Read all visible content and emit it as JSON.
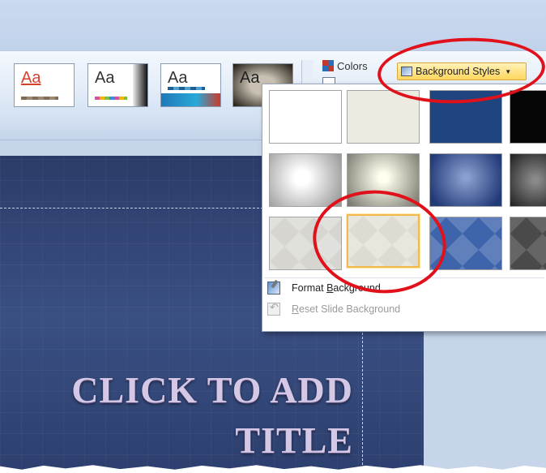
{
  "ribbon": {
    "themes": [
      {
        "label": "Aa"
      },
      {
        "label": "Aa"
      },
      {
        "label": "Aa"
      },
      {
        "label": "Aa"
      }
    ],
    "colors_label": "Colors",
    "background_styles_label": "Background Styles"
  },
  "dropdown": {
    "swatches": [
      {
        "name": "style-1",
        "color": "#ffffff"
      },
      {
        "name": "style-2",
        "color": "#ecebe2"
      },
      {
        "name": "style-3",
        "color": "#1f4580"
      },
      {
        "name": "style-4",
        "color": "#050505"
      },
      {
        "name": "style-5",
        "color": "#d0d0d0"
      },
      {
        "name": "style-6",
        "color": "#c6c5b8"
      },
      {
        "name": "style-7",
        "color": "#3a58a0"
      },
      {
        "name": "style-8",
        "color": "#3b3b3b"
      },
      {
        "name": "style-9",
        "color": "#d6d5d0"
      },
      {
        "name": "style-10",
        "color": "#dedcd0",
        "selected": true
      },
      {
        "name": "style-11",
        "color": "#3e64ac"
      },
      {
        "name": "style-12",
        "color": "#4a4a4a"
      }
    ],
    "menu": {
      "format_prefix": "Format ",
      "format_accel": "B",
      "format_suffix": "ackground",
      "reset_accel": "R",
      "reset_suffix": "eset Slide Background"
    }
  },
  "slide": {
    "title_line1": "CLICK TO ADD",
    "title_line2": "TITLE",
    "background_color": "#34497a"
  },
  "annotation_color": "#e0111b"
}
